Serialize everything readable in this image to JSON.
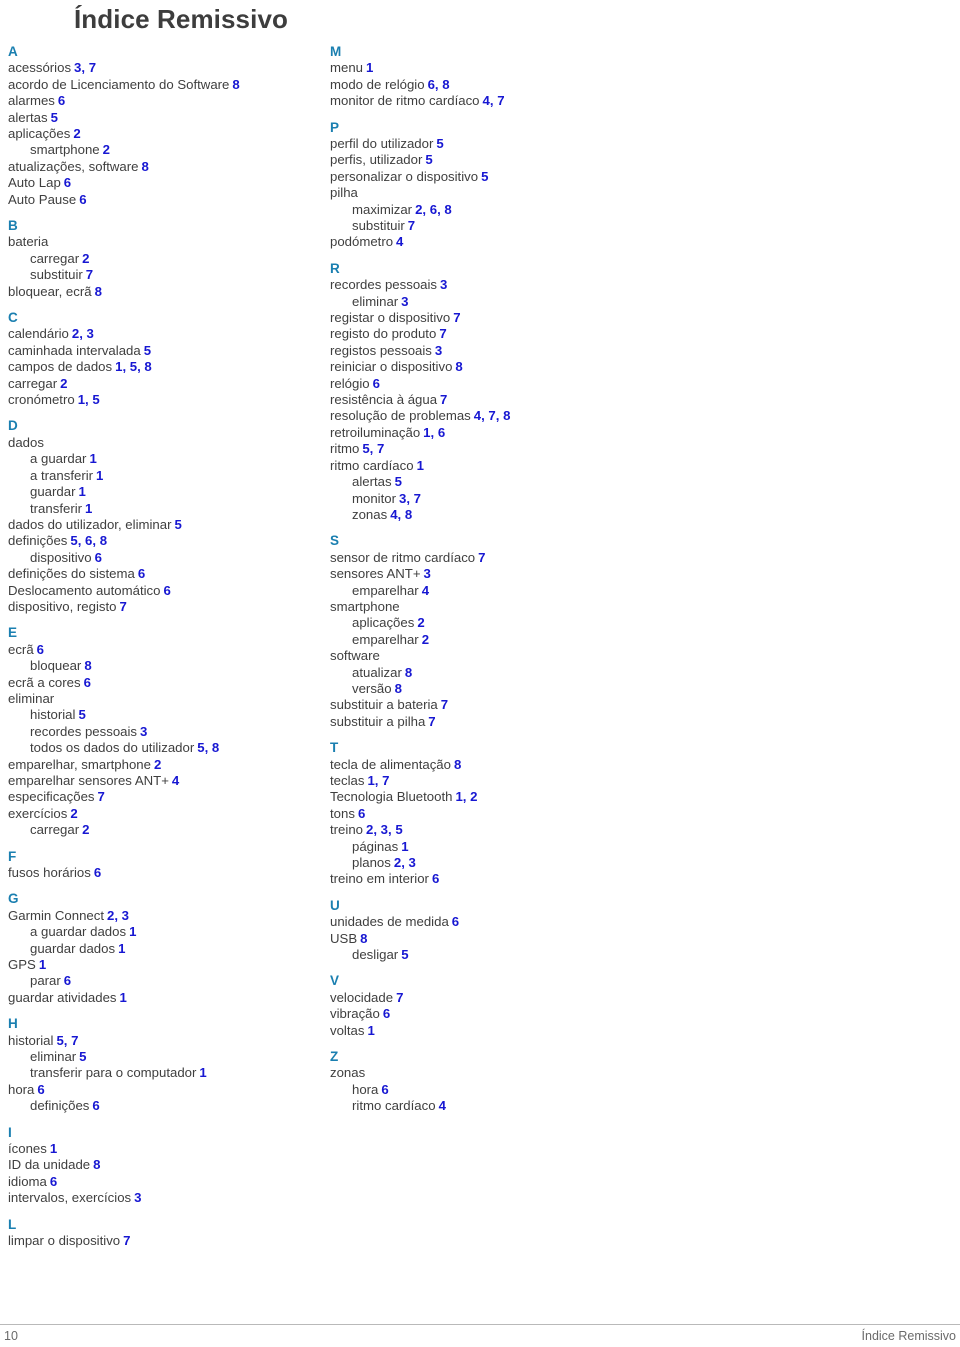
{
  "document": {
    "title": "Índice Remissivo",
    "footer": {
      "page_number": "10",
      "section_label": "Índice Remissivo"
    },
    "colors": {
      "letter_heading": "#1a7fb0",
      "page_reference": "#1717d2",
      "body_text": "#3f3f3f",
      "title_text": "#3d3d3d",
      "footer_text": "#6a6a6a",
      "rule": "#b9b9b9"
    }
  },
  "index": {
    "left_column": [
      {
        "letter": "A",
        "entries": [
          {
            "level": 1,
            "term": "acessórios",
            "pages": "3, 7"
          },
          {
            "level": 1,
            "term": "acordo de Licenciamento do Software",
            "pages": "8"
          },
          {
            "level": 1,
            "term": "alarmes",
            "pages": "6"
          },
          {
            "level": 1,
            "term": "alertas",
            "pages": "5"
          },
          {
            "level": 1,
            "term": "aplicações",
            "pages": "2"
          },
          {
            "level": 2,
            "term": "smartphone",
            "pages": "2"
          },
          {
            "level": 1,
            "term": "atualizações, software",
            "pages": "8"
          },
          {
            "level": 1,
            "term": "Auto Lap",
            "pages": "6"
          },
          {
            "level": 1,
            "term": "Auto Pause",
            "pages": "6"
          }
        ]
      },
      {
        "letter": "B",
        "entries": [
          {
            "level": 1,
            "term": "bateria",
            "pages": ""
          },
          {
            "level": 2,
            "term": "carregar",
            "pages": "2"
          },
          {
            "level": 2,
            "term": "substituir",
            "pages": "7"
          },
          {
            "level": 1,
            "term": "bloquear, ecrã",
            "pages": "8"
          }
        ]
      },
      {
        "letter": "C",
        "entries": [
          {
            "level": 1,
            "term": "calendário",
            "pages": "2, 3"
          },
          {
            "level": 1,
            "term": "caminhada intervalada",
            "pages": "5"
          },
          {
            "level": 1,
            "term": "campos de dados",
            "pages": "1, 5, 8"
          },
          {
            "level": 1,
            "term": "carregar",
            "pages": "2"
          },
          {
            "level": 1,
            "term": "cronómetro",
            "pages": "1, 5"
          }
        ]
      },
      {
        "letter": "D",
        "entries": [
          {
            "level": 1,
            "term": "dados",
            "pages": ""
          },
          {
            "level": 2,
            "term": "a guardar",
            "pages": "1"
          },
          {
            "level": 2,
            "term": "a transferir",
            "pages": "1"
          },
          {
            "level": 2,
            "term": "guardar",
            "pages": "1"
          },
          {
            "level": 2,
            "term": "transferir",
            "pages": "1"
          },
          {
            "level": 1,
            "term": "dados do utilizador, eliminar",
            "pages": "5"
          },
          {
            "level": 1,
            "term": "definições",
            "pages": "5, 6, 8"
          },
          {
            "level": 2,
            "term": "dispositivo",
            "pages": "6"
          },
          {
            "level": 1,
            "term": "definições do sistema",
            "pages": "6"
          },
          {
            "level": 1,
            "term": "Deslocamento automático",
            "pages": "6"
          },
          {
            "level": 1,
            "term": "dispositivo, registo",
            "pages": "7"
          }
        ]
      },
      {
        "letter": "E",
        "entries": [
          {
            "level": 1,
            "term": "ecrã",
            "pages": "6"
          },
          {
            "level": 2,
            "term": "bloquear",
            "pages": "8"
          },
          {
            "level": 1,
            "term": "ecrã a cores",
            "pages": "6"
          },
          {
            "level": 1,
            "term": "eliminar",
            "pages": ""
          },
          {
            "level": 2,
            "term": "historial",
            "pages": "5"
          },
          {
            "level": 2,
            "term": "recordes pessoais",
            "pages": "3"
          },
          {
            "level": 2,
            "term": "todos os dados do utilizador",
            "pages": "5, 8"
          },
          {
            "level": 1,
            "term": "emparelhar, smartphone",
            "pages": "2"
          },
          {
            "level": 1,
            "term": "emparelhar sensores ANT+",
            "pages": "4"
          },
          {
            "level": 1,
            "term": "especificações",
            "pages": "7"
          },
          {
            "level": 1,
            "term": "exercícios",
            "pages": "2"
          },
          {
            "level": 2,
            "term": "carregar",
            "pages": "2"
          }
        ]
      },
      {
        "letter": "F",
        "entries": [
          {
            "level": 1,
            "term": "fusos horários",
            "pages": "6"
          }
        ]
      },
      {
        "letter": "G",
        "entries": [
          {
            "level": 1,
            "term": "Garmin Connect",
            "pages": "2, 3"
          },
          {
            "level": 2,
            "term": "a guardar dados",
            "pages": "1"
          },
          {
            "level": 2,
            "term": "guardar dados",
            "pages": "1"
          },
          {
            "level": 1,
            "term": "GPS",
            "pages": "1"
          },
          {
            "level": 2,
            "term": "parar",
            "pages": "6"
          },
          {
            "level": 1,
            "term": "guardar atividades",
            "pages": "1"
          }
        ]
      },
      {
        "letter": "H",
        "entries": [
          {
            "level": 1,
            "term": "historial",
            "pages": "5, 7"
          },
          {
            "level": 2,
            "term": "eliminar",
            "pages": "5"
          },
          {
            "level": 2,
            "term": "transferir para o computador",
            "pages": "1"
          },
          {
            "level": 1,
            "term": "hora",
            "pages": "6"
          },
          {
            "level": 2,
            "term": "definições",
            "pages": "6"
          }
        ]
      },
      {
        "letter": "I",
        "entries": [
          {
            "level": 1,
            "term": "ícones",
            "pages": "1"
          },
          {
            "level": 1,
            "term": "ID da unidade",
            "pages": "8"
          },
          {
            "level": 1,
            "term": "idioma",
            "pages": "6"
          },
          {
            "level": 1,
            "term": "intervalos, exercícios",
            "pages": "3"
          }
        ]
      },
      {
        "letter": "L",
        "entries": [
          {
            "level": 1,
            "term": "limpar o dispositivo",
            "pages": "7"
          }
        ]
      }
    ],
    "right_column": [
      {
        "letter": "M",
        "entries": [
          {
            "level": 1,
            "term": "menu",
            "pages": "1"
          },
          {
            "level": 1,
            "term": "modo de relógio",
            "pages": "6, 8"
          },
          {
            "level": 1,
            "term": "monitor de ritmo cardíaco",
            "pages": "4, 7"
          }
        ]
      },
      {
        "letter": "P",
        "entries": [
          {
            "level": 1,
            "term": "perfil do utilizador",
            "pages": "5"
          },
          {
            "level": 1,
            "term": "perfis, utilizador",
            "pages": "5"
          },
          {
            "level": 1,
            "term": "personalizar o dispositivo",
            "pages": "5"
          },
          {
            "level": 1,
            "term": "pilha",
            "pages": ""
          },
          {
            "level": 2,
            "term": "maximizar",
            "pages": "2, 6, 8"
          },
          {
            "level": 2,
            "term": "substituir",
            "pages": "7"
          },
          {
            "level": 1,
            "term": "podómetro",
            "pages": "4"
          }
        ]
      },
      {
        "letter": "R",
        "entries": [
          {
            "level": 1,
            "term": "recordes pessoais",
            "pages": "3"
          },
          {
            "level": 2,
            "term": "eliminar",
            "pages": "3"
          },
          {
            "level": 1,
            "term": "registar o dispositivo",
            "pages": "7"
          },
          {
            "level": 1,
            "term": "registo do produto",
            "pages": "7"
          },
          {
            "level": 1,
            "term": "registos pessoais",
            "pages": "3"
          },
          {
            "level": 1,
            "term": "reiniciar o dispositivo",
            "pages": "8"
          },
          {
            "level": 1,
            "term": "relógio",
            "pages": "6"
          },
          {
            "level": 1,
            "term": "resistência à água",
            "pages": "7"
          },
          {
            "level": 1,
            "term": "resolução de problemas",
            "pages": "4, 7, 8"
          },
          {
            "level": 1,
            "term": "retroiluminação",
            "pages": "1, 6"
          },
          {
            "level": 1,
            "term": "ritmo",
            "pages": "5, 7"
          },
          {
            "level": 1,
            "term": "ritmo cardíaco",
            "pages": "1"
          },
          {
            "level": 2,
            "term": "alertas",
            "pages": "5"
          },
          {
            "level": 2,
            "term": "monitor",
            "pages": "3, 7"
          },
          {
            "level": 2,
            "term": "zonas",
            "pages": "4, 8"
          }
        ]
      },
      {
        "letter": "S",
        "entries": [
          {
            "level": 1,
            "term": "sensor de ritmo cardíaco",
            "pages": "7"
          },
          {
            "level": 1,
            "term": "sensores ANT+",
            "pages": "3"
          },
          {
            "level": 2,
            "term": "emparelhar",
            "pages": "4"
          },
          {
            "level": 1,
            "term": "smartphone",
            "pages": ""
          },
          {
            "level": 2,
            "term": "aplicações",
            "pages": "2"
          },
          {
            "level": 2,
            "term": "emparelhar",
            "pages": "2"
          },
          {
            "level": 1,
            "term": "software",
            "pages": ""
          },
          {
            "level": 2,
            "term": "atualizar",
            "pages": "8"
          },
          {
            "level": 2,
            "term": "versão",
            "pages": "8"
          },
          {
            "level": 1,
            "term": "substituir a bateria",
            "pages": "7"
          },
          {
            "level": 1,
            "term": "substituir a pilha",
            "pages": "7"
          }
        ]
      },
      {
        "letter": "T",
        "entries": [
          {
            "level": 1,
            "term": "tecla de alimentação",
            "pages": "8"
          },
          {
            "level": 1,
            "term": "teclas",
            "pages": "1, 7"
          },
          {
            "level": 1,
            "term": "Tecnologia Bluetooth",
            "pages": "1, 2"
          },
          {
            "level": 1,
            "term": "tons",
            "pages": "6"
          },
          {
            "level": 1,
            "term": "treino",
            "pages": "2, 3, 5"
          },
          {
            "level": 2,
            "term": "páginas",
            "pages": "1"
          },
          {
            "level": 2,
            "term": "planos",
            "pages": "2, 3"
          },
          {
            "level": 1,
            "term": "treino em interior",
            "pages": "6"
          }
        ]
      },
      {
        "letter": "U",
        "entries": [
          {
            "level": 1,
            "term": "unidades de medida",
            "pages": "6"
          },
          {
            "level": 1,
            "term": "USB",
            "pages": "8"
          },
          {
            "level": 2,
            "term": "desligar",
            "pages": "5"
          }
        ]
      },
      {
        "letter": "V",
        "entries": [
          {
            "level": 1,
            "term": "velocidade",
            "pages": "7"
          },
          {
            "level": 1,
            "term": "vibração",
            "pages": "6"
          },
          {
            "level": 1,
            "term": "voltas",
            "pages": "1"
          }
        ]
      },
      {
        "letter": "Z",
        "entries": [
          {
            "level": 1,
            "term": "zonas",
            "pages": ""
          },
          {
            "level": 2,
            "term": "hora",
            "pages": "6"
          },
          {
            "level": 2,
            "term": "ritmo cardíaco",
            "pages": "4"
          }
        ]
      }
    ]
  }
}
